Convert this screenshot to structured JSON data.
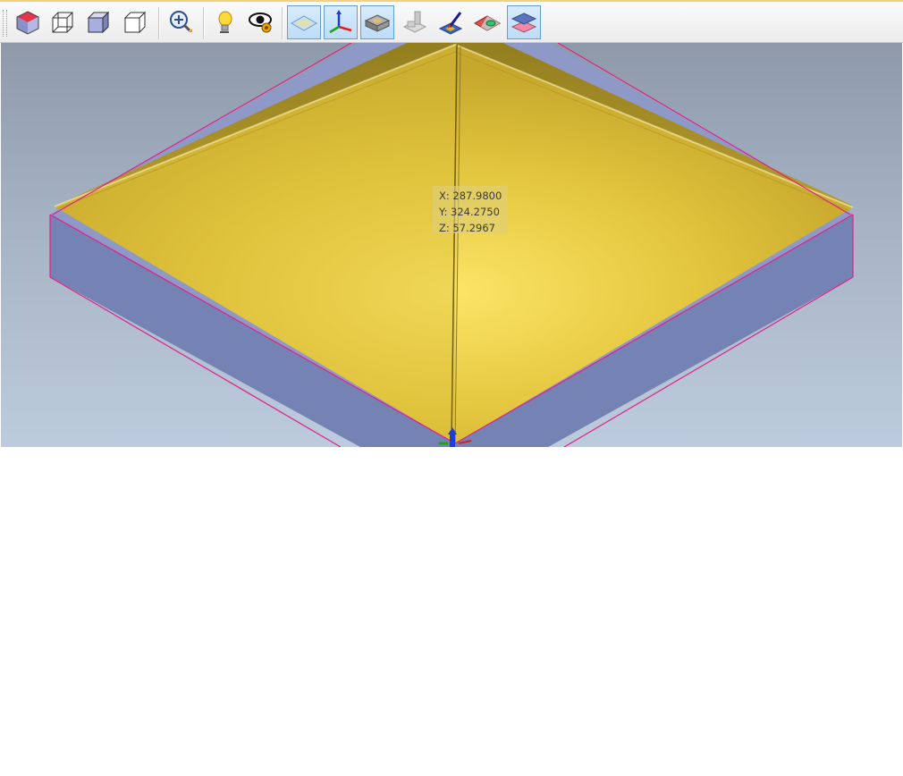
{
  "toolbar": {
    "buttons": [
      {
        "icon": "iso-cube-view-icon",
        "active": false
      },
      {
        "icon": "wireframe-cube-view-icon",
        "active": false
      },
      {
        "icon": "shaded-cube-view-icon",
        "active": false
      },
      {
        "icon": "hidden-line-cube-view-icon",
        "active": false
      },
      {
        "icon": "zoom-icon",
        "active": false
      },
      {
        "icon": "lightbulb-icon",
        "active": false
      },
      {
        "icon": "visibility-eye-icon",
        "active": false
      },
      {
        "icon": "stock-plane-icon",
        "active": true
      },
      {
        "icon": "xyz-axes-icon",
        "active": true
      },
      {
        "icon": "stock-model-icon",
        "active": true
      },
      {
        "icon": "toolpath-simulation-icon",
        "active": false
      },
      {
        "icon": "paint-brush-icon",
        "active": false
      },
      {
        "icon": "layer-materials-icon",
        "active": false
      },
      {
        "icon": "layers-icon",
        "active": true
      }
    ]
  },
  "viewport": {
    "background_top": "#8e9aaa",
    "background_bottom": "#bccbdd",
    "model_color": "#e0c540",
    "block_color": "#7583b4",
    "edge_color": "#e0208a"
  },
  "coords": {
    "x": "X: 287.9800",
    "y": "Y: 324.2750",
    "z": "Z: 57.2967"
  }
}
